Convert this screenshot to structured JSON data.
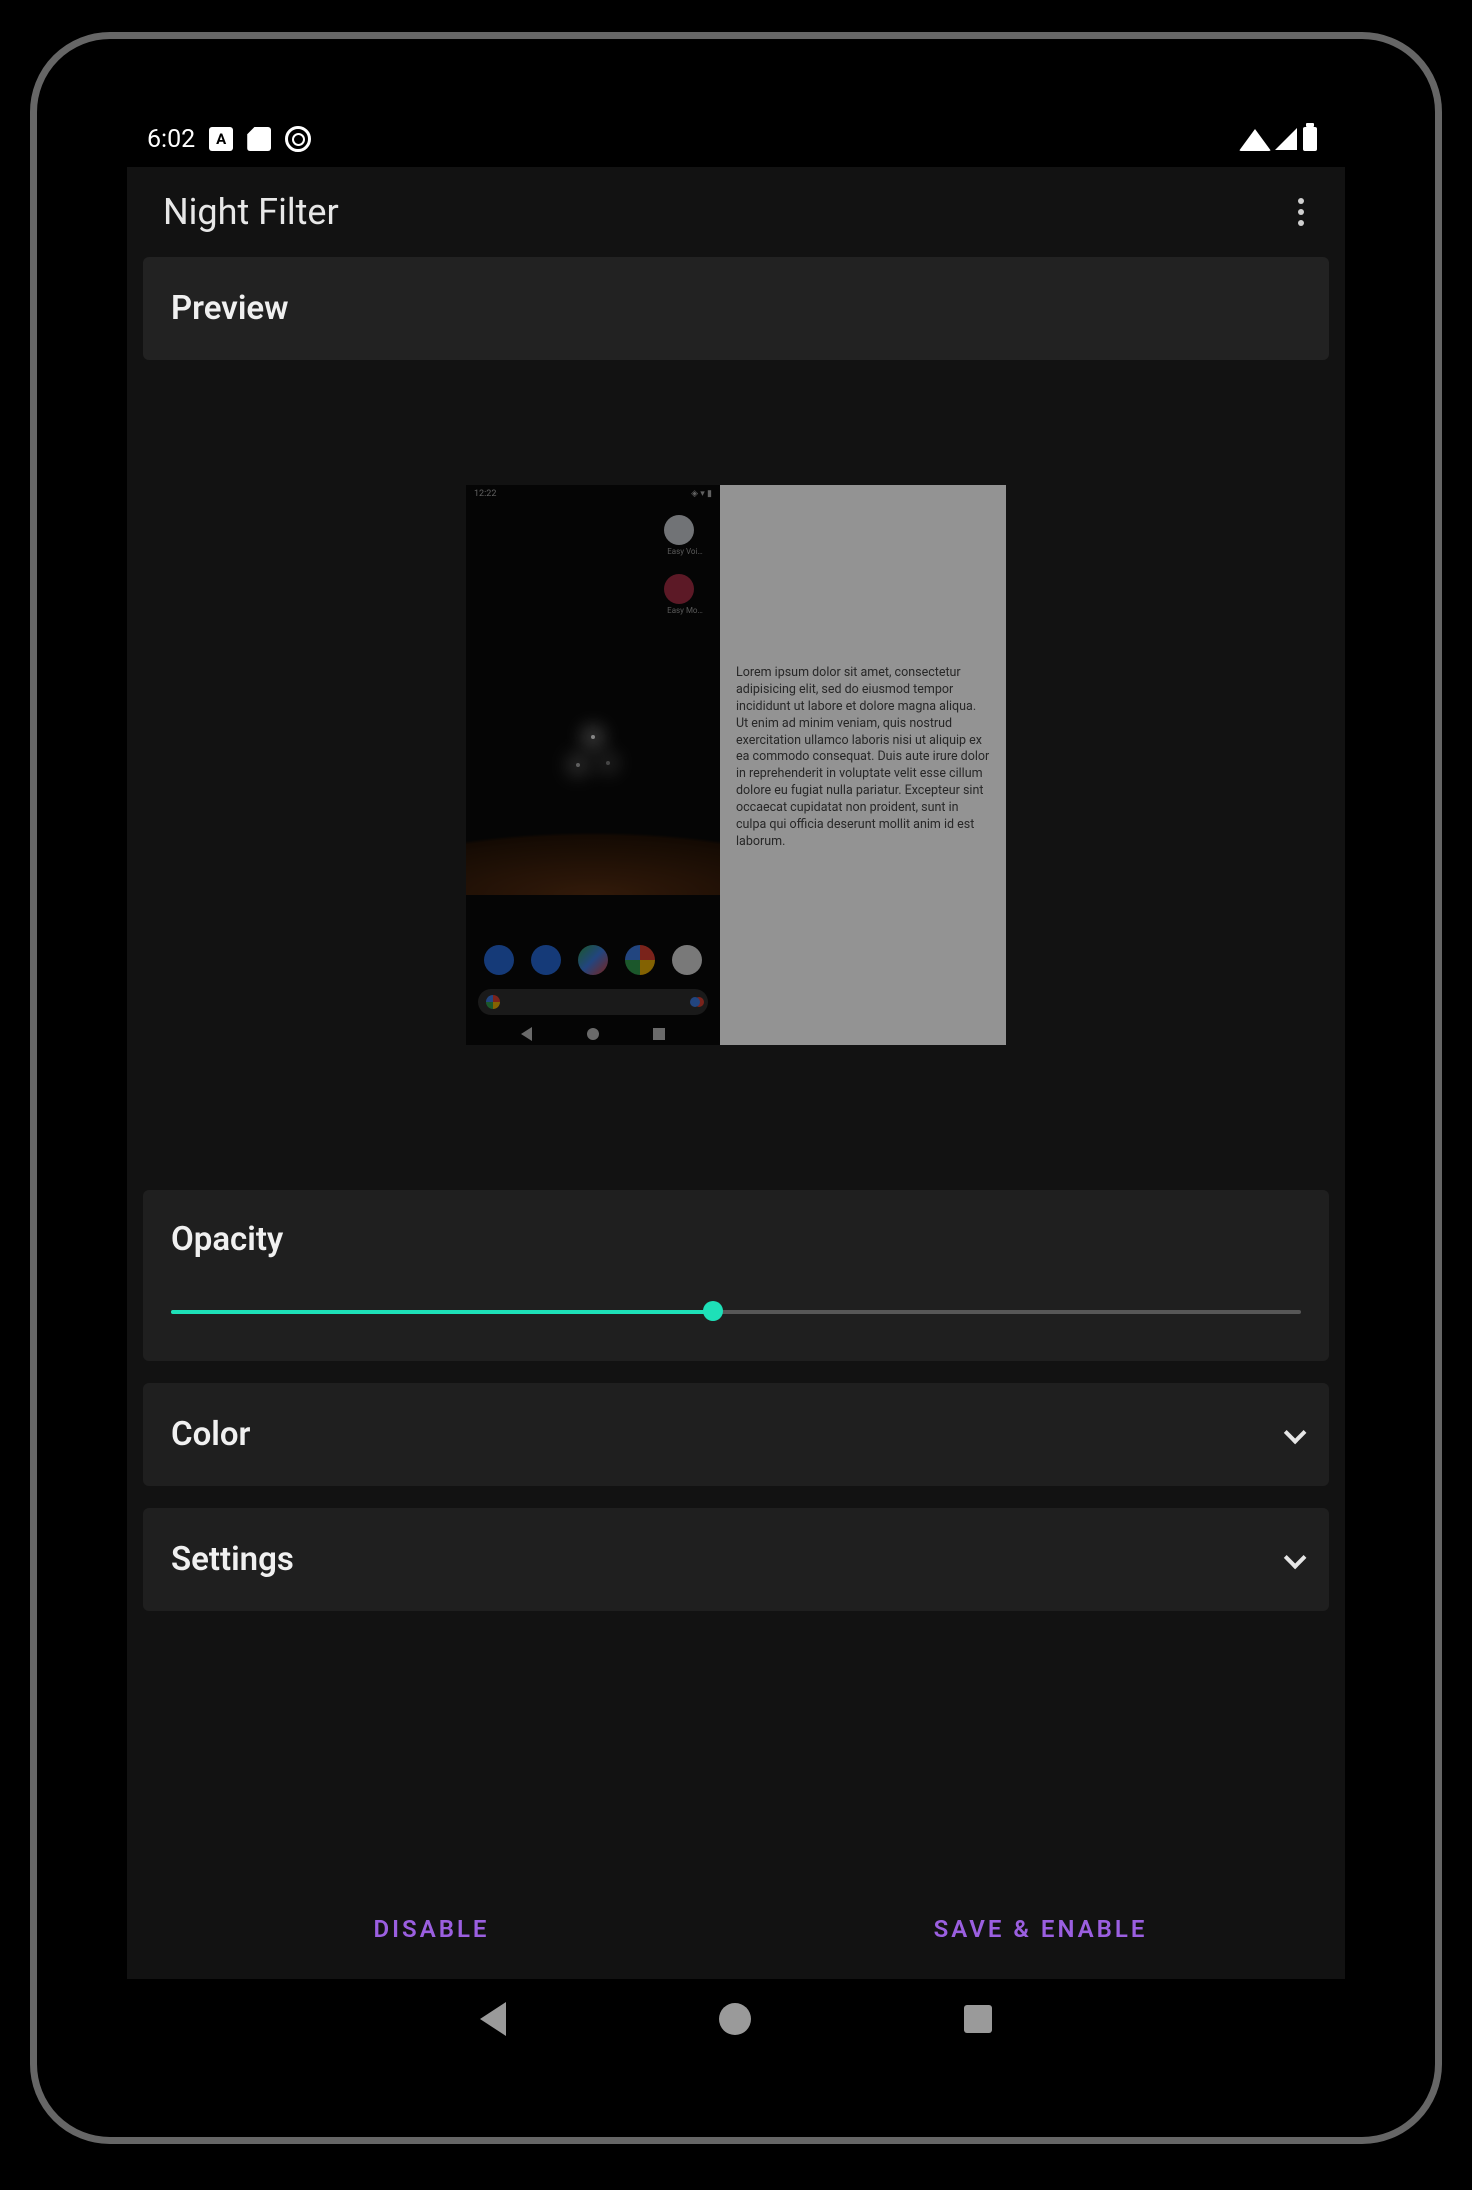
{
  "accent_color": "#1ee0b8",
  "button_color": "#9b5fe0",
  "status_bar": {
    "time": "6:02",
    "icons_left": [
      "a-icon",
      "sdcard-icon",
      "sync-off-icon"
    ],
    "icons_right": [
      "wifi-icon",
      "cell-icon",
      "battery-icon"
    ]
  },
  "app_bar": {
    "title": "Night Filter"
  },
  "sections": {
    "preview_label": "Preview",
    "opacity_label": "Opacity",
    "color_label": "Color",
    "settings_label": "Settings"
  },
  "opacity": {
    "value_pct": 48
  },
  "preview": {
    "mini_phone": {
      "time": "12:22",
      "icons_labels": [
        "Easy Voi…",
        "Easy Mo…"
      ],
      "dock_icons": [
        "phone",
        "messages",
        "play",
        "chrome",
        "camera"
      ]
    },
    "lorem": "Lorem ipsum dolor sit amet, consectetur adipisicing elit, sed do eiusmod tempor incididunt ut labore et dolore magna aliqua. Ut enim ad minim veniam, quis nostrud exercitation ullamco laboris nisi ut aliquip ex ea commodo consequat. Duis aute irure dolor in reprehenderit in voluptate velit esse cillum dolore eu fugiat nulla pariatur. Excepteur sint occaecat cupidatat non proident, sunt in culpa qui officia deserunt mollit anim id est laborum."
  },
  "actions": {
    "disable": "DISABLE",
    "save_enable": "SAVE & ENABLE"
  }
}
